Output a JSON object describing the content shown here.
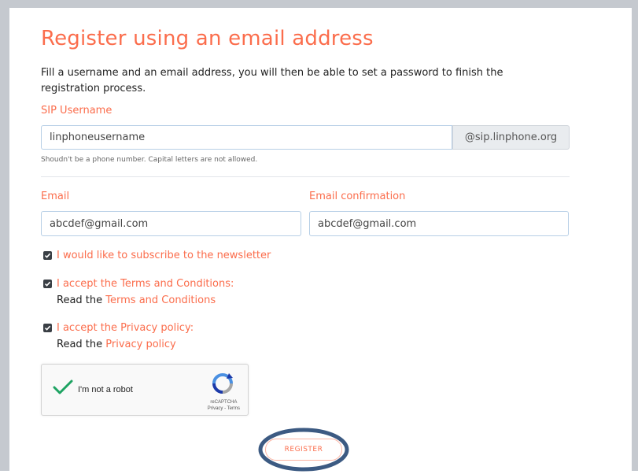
{
  "page": {
    "title": "Register using an email address",
    "description": "Fill a username and an email address, you will then be able to set a password to finish the registration process."
  },
  "form": {
    "sip_username_label": "SIP Username",
    "sip_username_value": "linphoneusername",
    "sip_domain_addon": "@sip.linphone.org",
    "sip_username_hint": "Shoudn't be a phone number. Capital letters are not allowed.",
    "email_label": "Email",
    "email_value": "abcdef@gmail.com",
    "email_confirm_label": "Email confirmation",
    "email_confirm_value": "abcdef@gmail.com",
    "newsletter": {
      "label": "I would like to subscribe to the newsletter",
      "checked": true
    },
    "terms": {
      "label": "I accept the Terms and Conditions:",
      "read_prefix": "Read the",
      "link": "Terms and Conditions",
      "checked": true
    },
    "privacy": {
      "label": "I accept the Privacy policy:",
      "read_prefix": "Read the",
      "link": "Privacy policy",
      "checked": true
    },
    "captcha": {
      "label": "I'm not a robot",
      "brand": "reCAPTCHA",
      "links": "Privacy - Terms",
      "checked": true
    },
    "register_label": "REGISTER"
  },
  "colors": {
    "accent": "#fb6d4c",
    "input_border": "#b7cfe6",
    "addon_bg": "#e9ecef",
    "check_green": "#1ea362",
    "highlight_ring": "#3c5a82"
  }
}
